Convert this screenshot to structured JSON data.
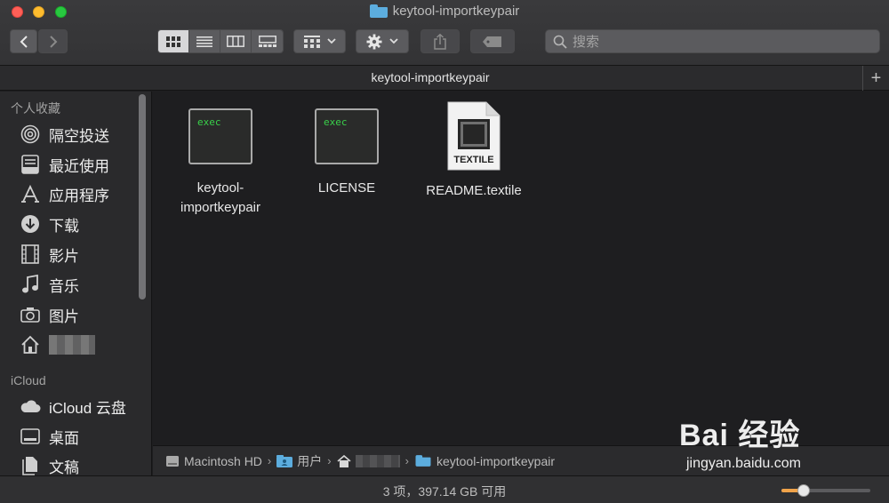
{
  "window": {
    "title": "keytool-importkeypair"
  },
  "toolbar": {
    "search_placeholder": "搜索"
  },
  "tab": {
    "title": "keytool-importkeypair",
    "add_label": "+"
  },
  "sidebar": {
    "favorites_header": "个人收藏",
    "favorites": [
      {
        "label": "隔空投送",
        "icon": "airdrop-icon"
      },
      {
        "label": "最近使用",
        "icon": "recents-icon"
      },
      {
        "label": "应用程序",
        "icon": "applications-icon"
      },
      {
        "label": "下载",
        "icon": "downloads-icon"
      },
      {
        "label": "影片",
        "icon": "movies-icon"
      },
      {
        "label": "音乐",
        "icon": "music-icon"
      },
      {
        "label": "图片",
        "icon": "pictures-icon"
      },
      {
        "label": "",
        "icon": "home-icon"
      }
    ],
    "icloud_header": "iCloud",
    "icloud": [
      {
        "label": "iCloud 云盘",
        "icon": "cloud-icon"
      },
      {
        "label": "桌面",
        "icon": "desktop-icon"
      },
      {
        "label": "文稿",
        "icon": "documents-icon"
      }
    ]
  },
  "files": [
    {
      "name_line1": "keytool-",
      "name_line2": "importkeypair",
      "icon_text": "exec",
      "kind": "exec"
    },
    {
      "name_line1": "LICENSE",
      "name_line2": "",
      "icon_text": "exec",
      "kind": "exec"
    },
    {
      "name_line1": "README.textile",
      "name_line2": "",
      "icon_text": "TEXTILE",
      "kind": "document"
    }
  ],
  "pathbar": {
    "items": [
      "Macintosh HD",
      "用户",
      "",
      "keytool-importkeypair"
    ]
  },
  "status": {
    "text": "3 项，397.14 GB 可用",
    "zoom_fraction": 0.25
  },
  "watermark": {
    "main": "Bai 经验",
    "sub": "jingyan.baidu.com"
  },
  "colors": {
    "accent": "#f0a34a",
    "folder": "#5cadde",
    "exec_text": "#39d04a"
  }
}
